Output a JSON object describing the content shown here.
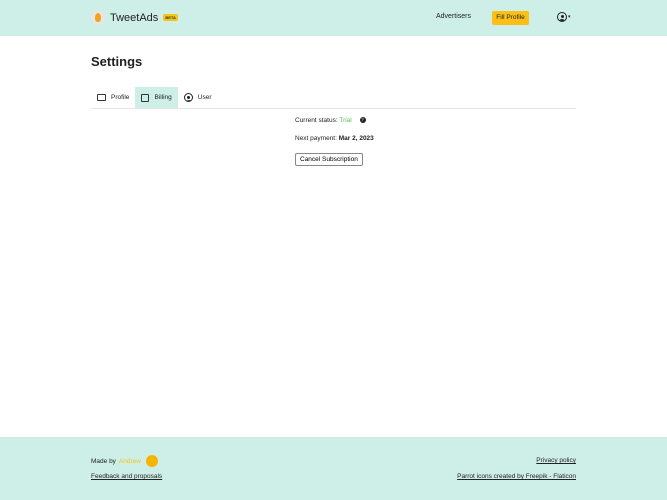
{
  "header": {
    "brand": "TweetAds",
    "badge": "BETA",
    "advertisers": "Advertisers",
    "fill_profile": "Fill Profile",
    "caret": "▾"
  },
  "page": {
    "title": "Settings"
  },
  "tabs": [
    {
      "label": "Profile"
    },
    {
      "label": "Billing"
    },
    {
      "label": "User"
    }
  ],
  "billing": {
    "status_label": "Current status:",
    "status_value": "Trial",
    "help": "?",
    "next_label": "Next payment:",
    "next_value": "Mar 2, 2023",
    "cancel": "Cancel Subscription"
  },
  "footer": {
    "made_by": "Made by",
    "author": "Andrew",
    "feedback": "Feedback and proposals",
    "privacy": "Privacy policy",
    "credits": "Parrot icons created by Freepik - Flaticon"
  },
  "colors": {
    "accent": "#cdefe8",
    "button": "#fbbf16",
    "trial": "#5cc05c"
  }
}
